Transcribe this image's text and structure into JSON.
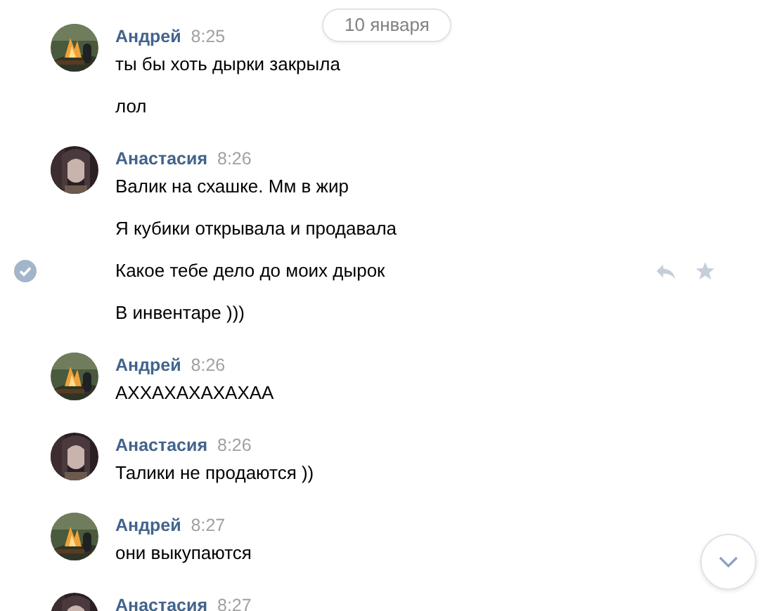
{
  "date_separator": "10 января",
  "groups": [
    {
      "author": "Андрей",
      "time": "8:25",
      "avatar": {
        "kind": "picture"
      },
      "messages": [
        {
          "text": "ты бы хоть дырки закрыла",
          "hover": false
        },
        {
          "text": "лол",
          "hover": false
        }
      ]
    },
    {
      "author": "Анастасия",
      "time": "8:26",
      "avatar": {
        "kind": "picture"
      },
      "messages": [
        {
          "text": "Валик на схашке. Мм в жир",
          "hover": false
        },
        {
          "text": "Я кубики открывала и продавала",
          "hover": false
        },
        {
          "text": "Какое тебе дело до моих дырок",
          "hover": true
        },
        {
          "text": "В инвентаре )))",
          "hover": false
        }
      ]
    },
    {
      "author": "Андрей",
      "time": "8:26",
      "avatar": {
        "kind": "picture"
      },
      "messages": [
        {
          "text": "АХХАХАХАХАХАА",
          "hover": false
        }
      ]
    },
    {
      "author": "Анастасия",
      "time": "8:26",
      "avatar": {
        "kind": "picture"
      },
      "messages": [
        {
          "text": "Талики не продаются ))",
          "hover": false
        }
      ]
    },
    {
      "author": "Андрей",
      "time": "8:27",
      "avatar": {
        "kind": "picture"
      },
      "messages": [
        {
          "text": "они выкупаются",
          "hover": false
        }
      ]
    },
    {
      "author": "Анастасия",
      "time": "8:27",
      "avatar": {
        "kind": "picture"
      }
    }
  ],
  "scroll_down_button": true
}
